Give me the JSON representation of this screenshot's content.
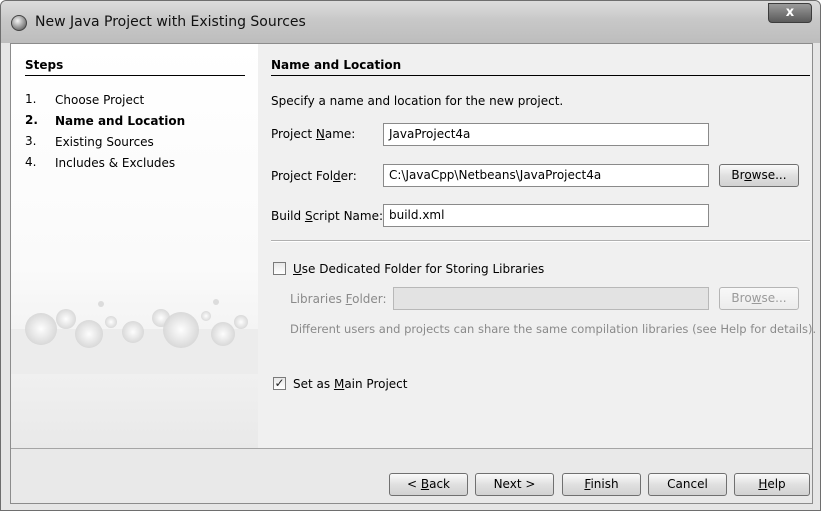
{
  "window": {
    "title": "New Java Project with Existing Sources",
    "close_label": "x"
  },
  "steps": {
    "heading": "Steps",
    "items": [
      {
        "num": "1.",
        "label": "Choose Project"
      },
      {
        "num": "2.",
        "label": "Name and Location"
      },
      {
        "num": "3.",
        "label": "Existing Sources"
      },
      {
        "num": "4.",
        "label": "Includes & Excludes"
      }
    ],
    "current_index": 1
  },
  "main": {
    "heading": "Name and Location",
    "description": "Specify a name and location for the new project.",
    "project_name": {
      "label_pre": "Project ",
      "label_mn": "N",
      "label_post": "ame:",
      "value": "JavaProject4a"
    },
    "project_folder": {
      "label_pre": "Project Fol",
      "label_mn": "d",
      "label_post": "er:",
      "value": "C:\\JavaCpp\\Netbeans\\JavaProject4a"
    },
    "build_script": {
      "label_pre": "Build ",
      "label_mn": "S",
      "label_post": "cript Name:",
      "value": "build.xml"
    },
    "browse_folder": {
      "pre": "Br",
      "mn": "o",
      "post": "wse..."
    },
    "dedicated_folder": {
      "mn": "U",
      "post": "se Dedicated Folder for Storing Libraries",
      "checked": false
    },
    "libraries_folder": {
      "label_pre": "Libraries ",
      "label_mn": "F",
      "label_post": "older:",
      "value": ""
    },
    "browse_libraries": {
      "pre": "Bro",
      "mn": "w",
      "post": "se..."
    },
    "libraries_note": "Different users and projects can share the same compilation libraries (see Help for details).",
    "main_project": {
      "pre": "Set as ",
      "mn": "M",
      "post": "ain Project",
      "checked": true,
      "mark": "✓"
    }
  },
  "footer": {
    "back": {
      "pre": "< ",
      "mn": "B",
      "post": "ack"
    },
    "next": "Next >",
    "finish": {
      "mn": "F",
      "post": "inish"
    },
    "cancel": "Cancel",
    "help": {
      "mn": "H",
      "post": "elp"
    }
  }
}
